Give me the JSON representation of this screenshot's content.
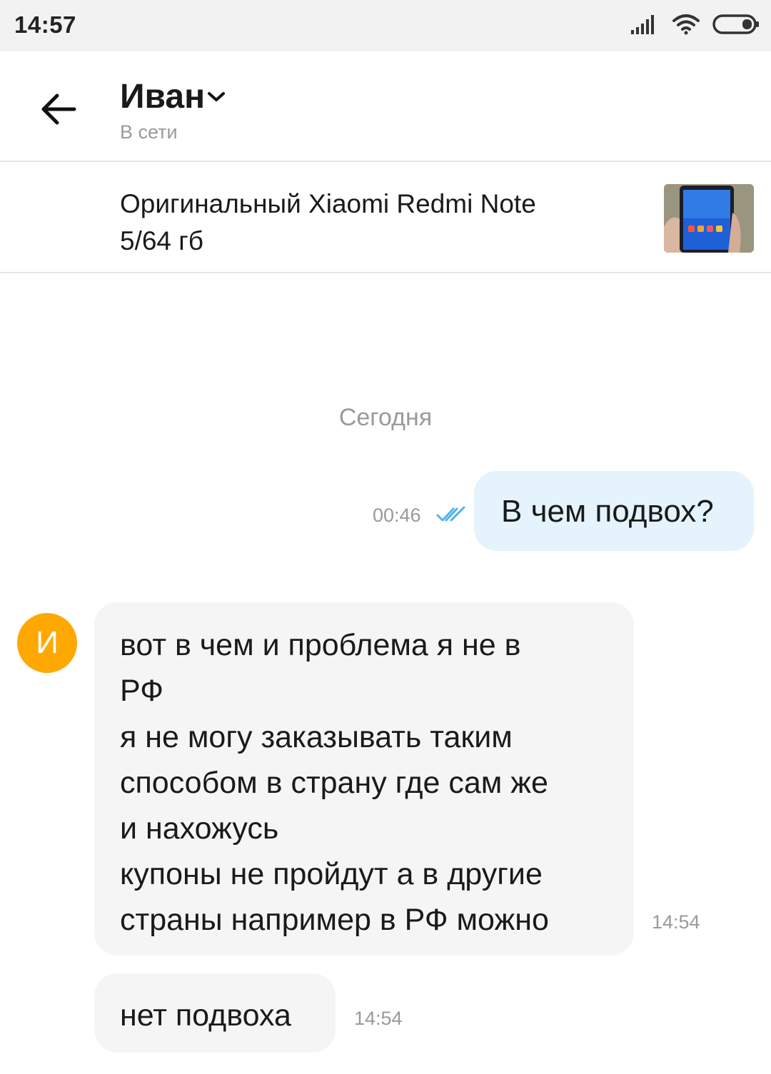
{
  "status_bar": {
    "time": "14:57",
    "icons": [
      "signal-icon",
      "wifi-icon",
      "battery-icon"
    ]
  },
  "header": {
    "contact_name": "Иван",
    "contact_status": "В сети",
    "icons": [
      "back-arrow-icon",
      "chevron-down-icon"
    ]
  },
  "product": {
    "title_line1": "Оригинальный Xiaomi Redmi Note",
    "title_line2": "5/64 гб"
  },
  "chat": {
    "date_separator": "Сегодня",
    "messages": [
      {
        "direction": "outgoing",
        "lines": [
          "В чем подвох?"
        ],
        "time": "00:46",
        "status": "read"
      },
      {
        "direction": "incoming",
        "avatar_letter": "И",
        "lines": [
          "вот в чем и проблема я не в",
          "РФ",
          "я не могу заказывать таким",
          "способом в страну где сам же",
          "и нахожусь",
          "купоны не пройдут а в другие",
          "страны например в РФ можно"
        ],
        "time": "14:54"
      },
      {
        "direction": "incoming",
        "lines": [
          "нет подвоха"
        ],
        "time": "14:54"
      }
    ]
  },
  "colors": {
    "status_bar_bg": "#f2f2f2",
    "outgoing_bubble": "#e4f3fc",
    "incoming_bubble": "#f5f5f5",
    "avatar": "#ffa802",
    "read_ticks": "#4fb3ea",
    "muted_text": "#9a9a9a"
  }
}
